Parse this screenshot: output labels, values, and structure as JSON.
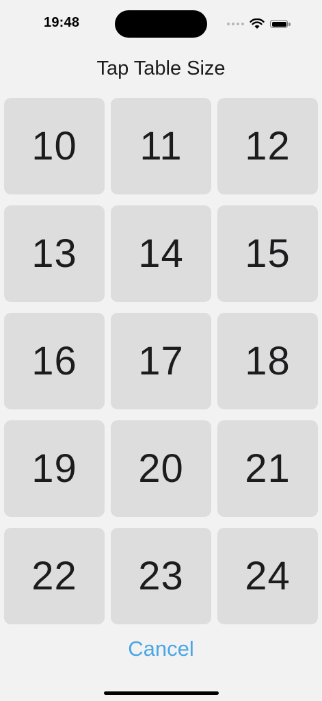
{
  "status_bar": {
    "time": "19:48"
  },
  "header": {
    "title": "Tap Table Size"
  },
  "sizes": [
    "10",
    "11",
    "12",
    "13",
    "14",
    "15",
    "16",
    "17",
    "18",
    "19",
    "20",
    "21",
    "22",
    "23",
    "24"
  ],
  "footer": {
    "cancel_label": "Cancel"
  },
  "colors": {
    "background": "#f2f2f2",
    "button": "#dddddd",
    "accent": "#4aa6e6"
  }
}
